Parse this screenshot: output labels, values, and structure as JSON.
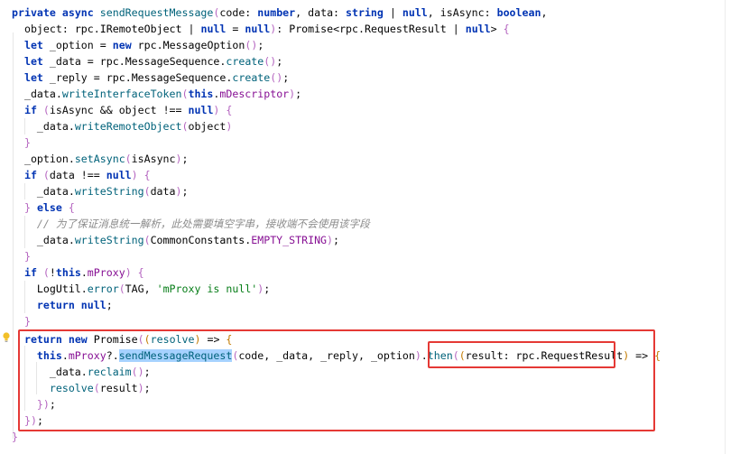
{
  "lines": [
    "private async sendRequestMessage(code: number, data: string | null, isAsync: boolean,",
    "  object: rpc.IRemoteObject | null = null): Promise<rpc.RequestResult | null> {",
    "  let _option = new rpc.MessageOption();",
    "  let _data = rpc.MessageSequence.create();",
    "  let _reply = rpc.MessageSequence.create();",
    "  _data.writeInterfaceToken(this.mDescriptor);",
    "  if (isAsync && object !== null) {",
    "    _data.writeRemoteObject(object)",
    "  }",
    "  _option.setAsync(isAsync);",
    "  if (data !== null) {",
    "    _data.writeString(data);",
    "  } else {",
    "    // 为了保证消息统一解析，此处需要填空字串，接收端不会使用该字段",
    "    _data.writeString(CommonConstants.EMPTY_STRING);",
    "  }",
    "  if (!this.mProxy) {",
    "    LogUtil.error(TAG, 'mProxy is null');",
    "    return null;",
    "  }",
    "  return new Promise((resolve) => {",
    "    this.mProxy?.sendMessageRequest(code, _data, _reply, _option).then((result: rpc.RequestResult) => {",
    "      _data.reclaim();",
    "      resolve(result);",
    "    });",
    "  });",
    "}"
  ],
  "colors": {
    "keyword": "#0033b3",
    "function": "#00627a",
    "property": "#871094",
    "string": "#067d17",
    "comment": "#8c8c8c",
    "highlight": "#a6d2ff",
    "annotation_box": "#e53935"
  },
  "gutter": {
    "icon": "lightbulb-icon"
  }
}
